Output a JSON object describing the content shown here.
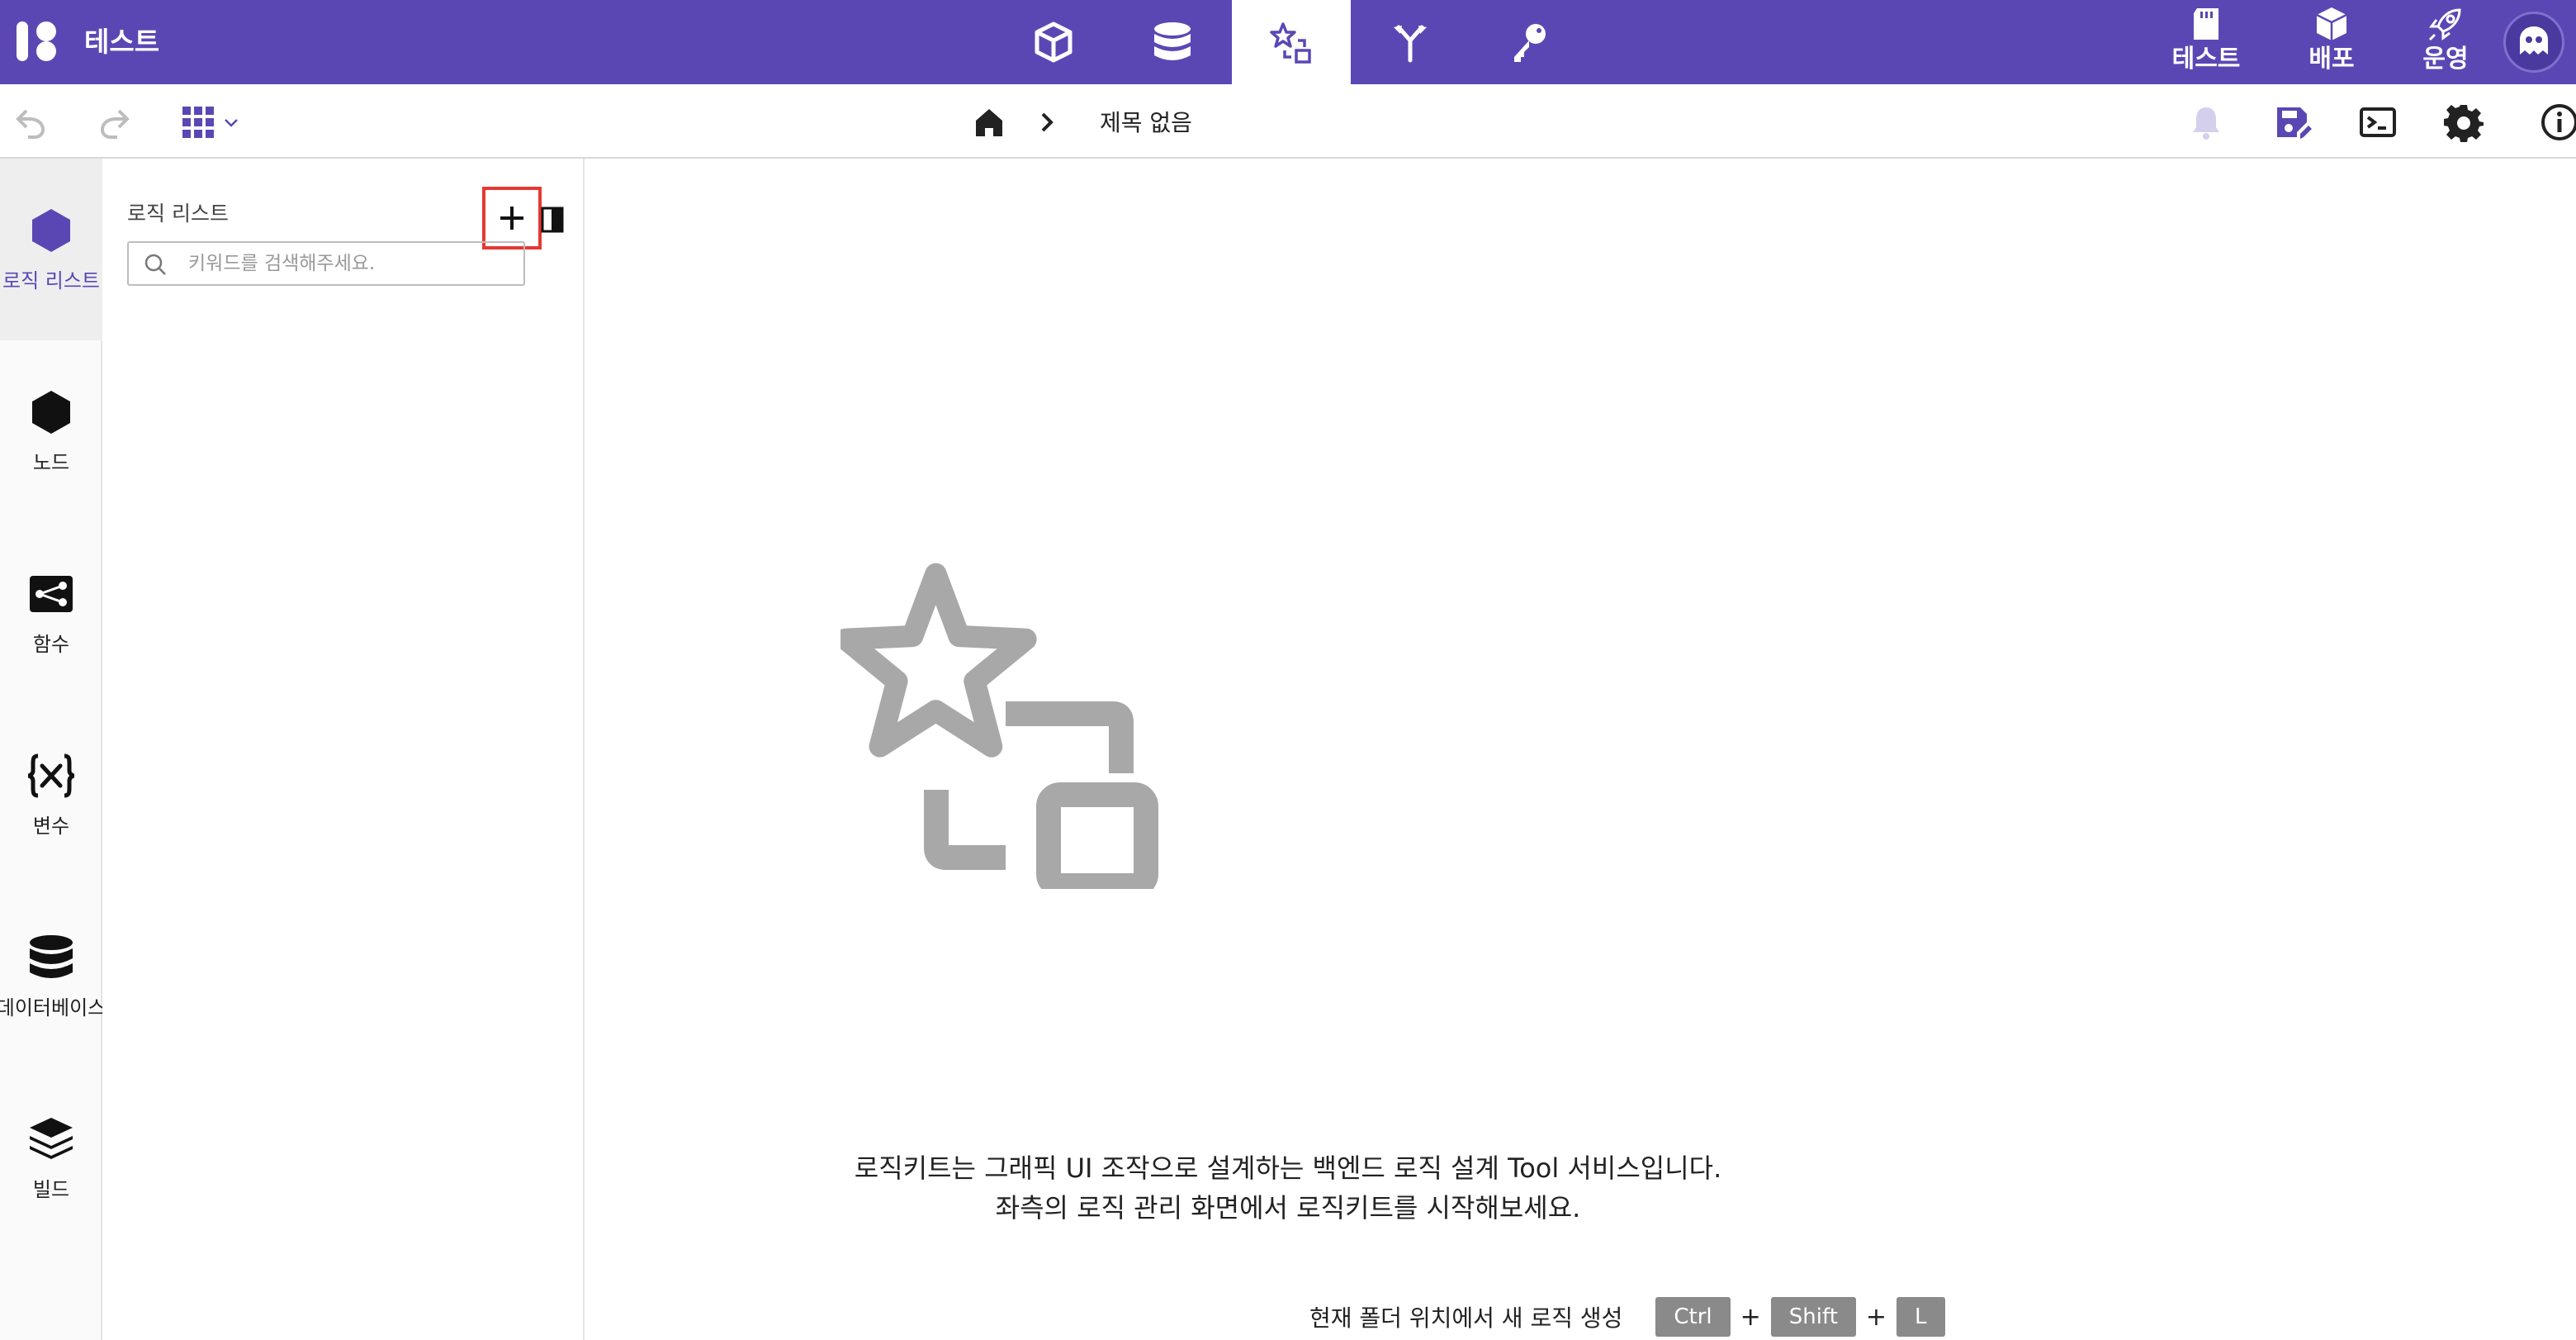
{
  "app": {
    "project_title": "테스트"
  },
  "top_nav": {
    "tabs": [
      {
        "icon": "cube-outline-icon",
        "active": false
      },
      {
        "icon": "database-icon",
        "active": false
      },
      {
        "icon": "logic-shapes-icon",
        "active": true
      },
      {
        "icon": "branch-icon",
        "active": false
      },
      {
        "icon": "key-icon",
        "active": false
      }
    ],
    "right": {
      "test_label": "테스트",
      "deploy_label": "배포",
      "ops_label": "운영"
    }
  },
  "toolbar": {
    "breadcrumb_title": "제목 없음"
  },
  "rail": {
    "items": [
      {
        "label": "로직 리스트",
        "icon": "hexagon-icon",
        "active": true
      },
      {
        "label": "노드",
        "icon": "hexagon-icon",
        "active": false
      },
      {
        "label": "함수",
        "icon": "function-node-icon",
        "active": false
      },
      {
        "label": "변수",
        "icon": "variable-icon",
        "active": false
      },
      {
        "label": "데이터베이스",
        "icon": "database-icon",
        "active": false
      },
      {
        "label": "빌드",
        "icon": "layers-icon",
        "active": false
      }
    ]
  },
  "panel": {
    "title": "로직 리스트",
    "search_placeholder": "키워드를 검색해주세요."
  },
  "empty_state": {
    "line1": "로직키트는 그래픽 UI 조작으로 설계하는 백엔드 로직 설계 Tool 서비스입니다.",
    "line2": "좌측의 로직 관리 화면에서 로직키트를 시작해보세요.",
    "shortcut_label": "현재 폴더 위치에서 새 로직 생성",
    "keys": [
      "Ctrl",
      "Shift",
      "L"
    ],
    "plus": "+"
  },
  "colors": {
    "brand": "#5b47b4",
    "highlight_box": "#e53935",
    "key_bg": "#8a8a8a",
    "empty_icon": "#a8a8a8"
  }
}
